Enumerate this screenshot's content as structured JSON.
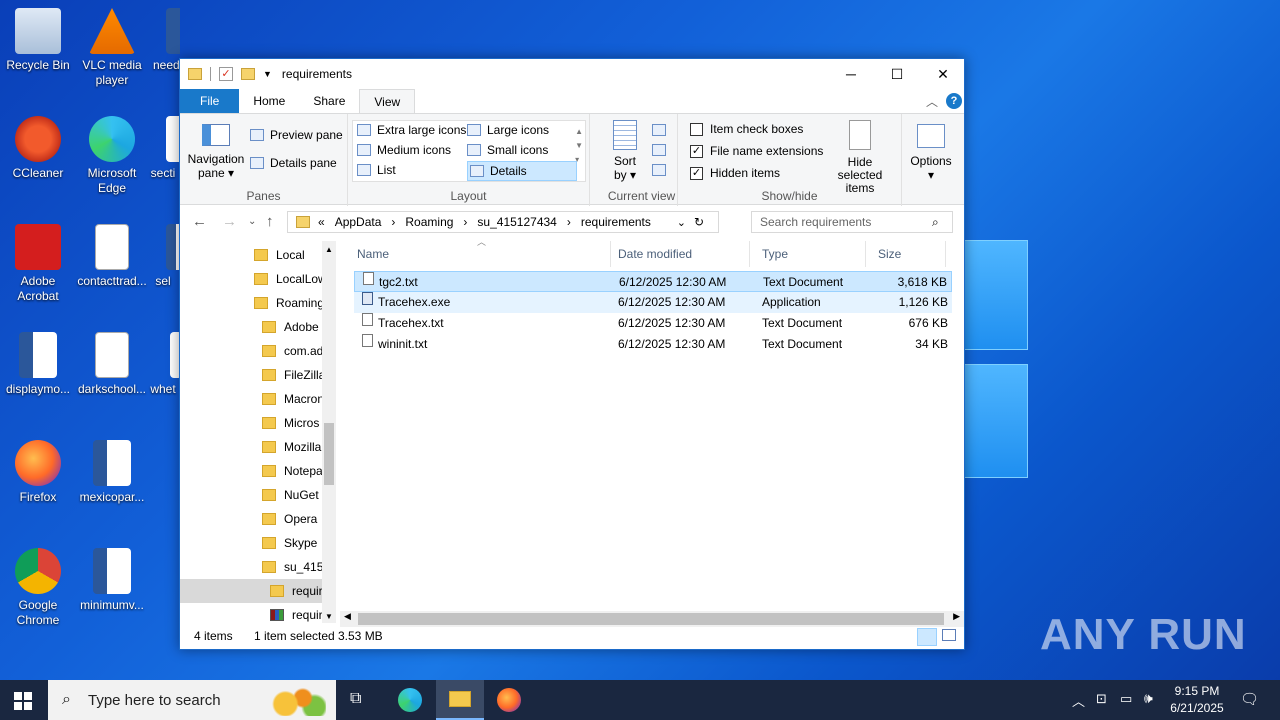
{
  "desktop": {
    "icons": [
      {
        "label": "Recycle Bin"
      },
      {
        "label": "VLC media player"
      },
      {
        "label": "need"
      },
      {
        "label": "CCleaner"
      },
      {
        "label": "Microsoft Edge"
      },
      {
        "label": "secti"
      },
      {
        "label": "Adobe Acrobat"
      },
      {
        "label": "contacttrad..."
      },
      {
        "label": "sel"
      },
      {
        "label": "displaymo..."
      },
      {
        "label": "darkschool..."
      },
      {
        "label": "whet"
      },
      {
        "label": "Firefox"
      },
      {
        "label": "mexicopar..."
      },
      {
        "label": "Google Chrome"
      },
      {
        "label": "minimumv..."
      }
    ],
    "watermark": "ANY RUN"
  },
  "window": {
    "title": "requirements",
    "minimize": "─",
    "maximize": "☐",
    "close": "✕"
  },
  "ribbon": {
    "tabs": [
      "File",
      "Home",
      "Share",
      "View"
    ],
    "active_tab": "View",
    "panes": {
      "label": "Panes",
      "navigation_pane": "Navigation pane",
      "preview_pane": "Preview pane",
      "details_pane": "Details pane"
    },
    "layout": {
      "label": "Layout",
      "items": [
        "Extra large icons",
        "Large icons",
        "Medium icons",
        "Small icons",
        "List",
        "Details"
      ],
      "selected": "Details"
    },
    "current_view": {
      "label": "Current view",
      "sort_by": "Sort by"
    },
    "show_hide": {
      "label": "Show/hide",
      "item_check_boxes": "Item check boxes",
      "item_check_boxes_checked": false,
      "file_name_extensions": "File name extensions",
      "file_name_extensions_checked": true,
      "hidden_items": "Hidden items",
      "hidden_items_checked": true,
      "hide_selected": "Hide selected items"
    },
    "options": "Options"
  },
  "address": {
    "breadcrumb": [
      "«",
      "AppData",
      "›",
      "Roaming",
      "›",
      "su_415127434",
      "›",
      "requirements"
    ],
    "search_placeholder": "Search requirements"
  },
  "nav_pane": {
    "items": [
      {
        "label": "Local",
        "indent": 0
      },
      {
        "label": "LocalLow",
        "indent": 0
      },
      {
        "label": "Roaming",
        "indent": 0
      },
      {
        "label": "Adobe",
        "indent": 1
      },
      {
        "label": "com.ad",
        "indent": 1
      },
      {
        "label": "FileZilla",
        "indent": 1
      },
      {
        "label": "Macron",
        "indent": 1
      },
      {
        "label": "Micros",
        "indent": 1
      },
      {
        "label": "Mozilla",
        "indent": 1
      },
      {
        "label": "Notepa",
        "indent": 1
      },
      {
        "label": "NuGet",
        "indent": 1
      },
      {
        "label": "Opera",
        "indent": 1
      },
      {
        "label": "Skype",
        "indent": 1
      },
      {
        "label": "su_415",
        "indent": 1
      },
      {
        "label": "requir",
        "indent": 2
      },
      {
        "label": "requir",
        "indent": 2
      }
    ]
  },
  "files": {
    "columns": [
      "Name",
      "Date modified",
      "Type",
      "Size"
    ],
    "rows": [
      {
        "name": "tgc2.txt",
        "date": "6/12/2025 12:30 AM",
        "type": "Text Document",
        "size": "3,618 KB",
        "state": "selected"
      },
      {
        "name": "Tracehex.exe",
        "date": "6/12/2025 12:30 AM",
        "type": "Application",
        "size": "1,126 KB",
        "state": "hover"
      },
      {
        "name": "Tracehex.txt",
        "date": "6/12/2025 12:30 AM",
        "type": "Text Document",
        "size": "676 KB",
        "state": ""
      },
      {
        "name": "wininit.txt",
        "date": "6/12/2025 12:30 AM",
        "type": "Text Document",
        "size": "34 KB",
        "state": ""
      }
    ]
  },
  "status": {
    "count": "4 items",
    "selected": "1 item selected",
    "size": "3.53 MB"
  },
  "taskbar": {
    "search_placeholder": "Type here to search",
    "time": "9:15 PM",
    "date": "6/21/2025"
  },
  "colors": {
    "accent": "#1979ca",
    "selection": "#cce8ff",
    "desktop": "#1260d8",
    "taskbar": "#1a2740"
  }
}
